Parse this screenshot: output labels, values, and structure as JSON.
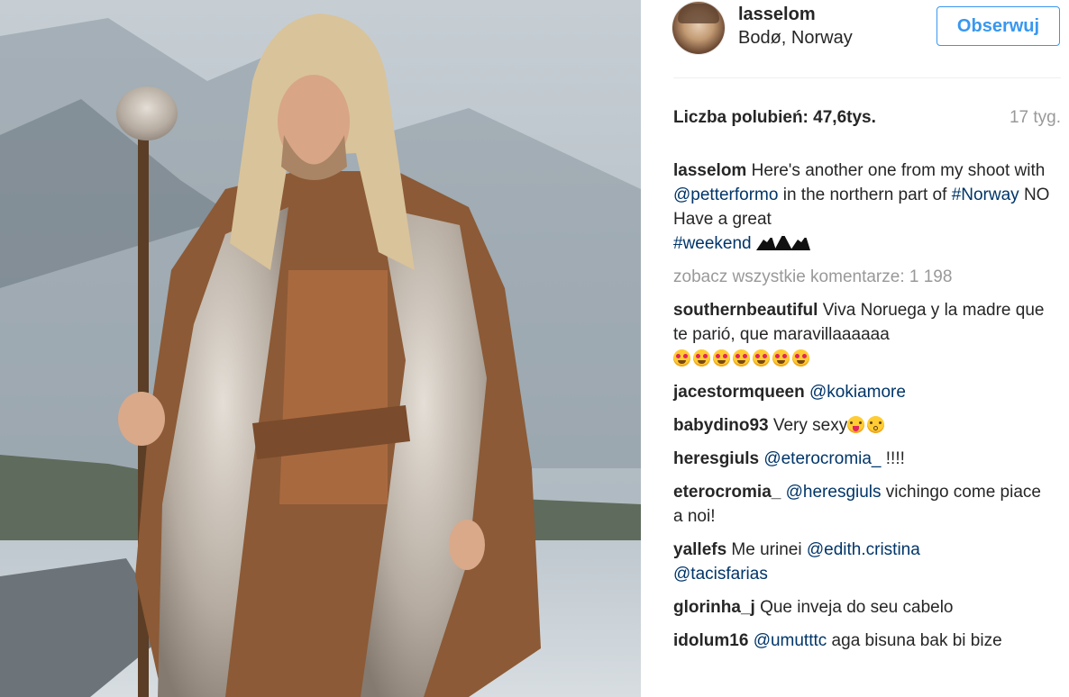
{
  "post": {
    "username": "lasselom",
    "location": "Bodø, Norway",
    "follow_label": "Obserwuj",
    "likes_text": "Liczba polubień: 47,6tys.",
    "age": "17 tyg."
  },
  "caption": {
    "username": "lasselom",
    "t1": " Here's another one from my shoot with ",
    "mention1": "@petterformo",
    "t2": " in the northern part of ",
    "hashtag1": "#Norway",
    "t3": " NO Have a great ",
    "hashtag2": "#weekend"
  },
  "view_all": "zobacz wszystkie komentarze: 1 198",
  "comments": [
    {
      "user": "southernbeautiful",
      "text": " Viva Noruega y la madre que te parió, que maravillaaaaaa "
    },
    {
      "user": "jacestormqueen",
      "mention": "@kokiamore"
    },
    {
      "user": "babydino93",
      "text": " Very sexy"
    },
    {
      "user": "heresgiuls",
      "mention": "@eterocromia_",
      "after": " !!!!"
    },
    {
      "user": "eterocromia_",
      "mention": "@heresgiuls",
      "after": " vichingo come piace a noi!"
    },
    {
      "user": "yallefs",
      "text": " Me urinei ",
      "mention": "@edith.cristina",
      "mention2": "@tacisfarias"
    },
    {
      "user": "glorinha_j",
      "text": " Que inveja do seu cabelo"
    },
    {
      "user": "idolum16",
      "mention": "@umutttc",
      "after": " aga bisuna bak bi bize"
    }
  ],
  "icons": {
    "avatar": "profile-photo",
    "emoji_heart_eyes": "heart-eyes-emoji",
    "emoji_tongue": "tongue-emoji",
    "emoji_kiss": "kiss-emoji",
    "mountain": "mountain-emoji"
  },
  "colors": {
    "link": "#003569",
    "follow": "#3897f0",
    "muted": "#999999",
    "text": "#262626"
  }
}
